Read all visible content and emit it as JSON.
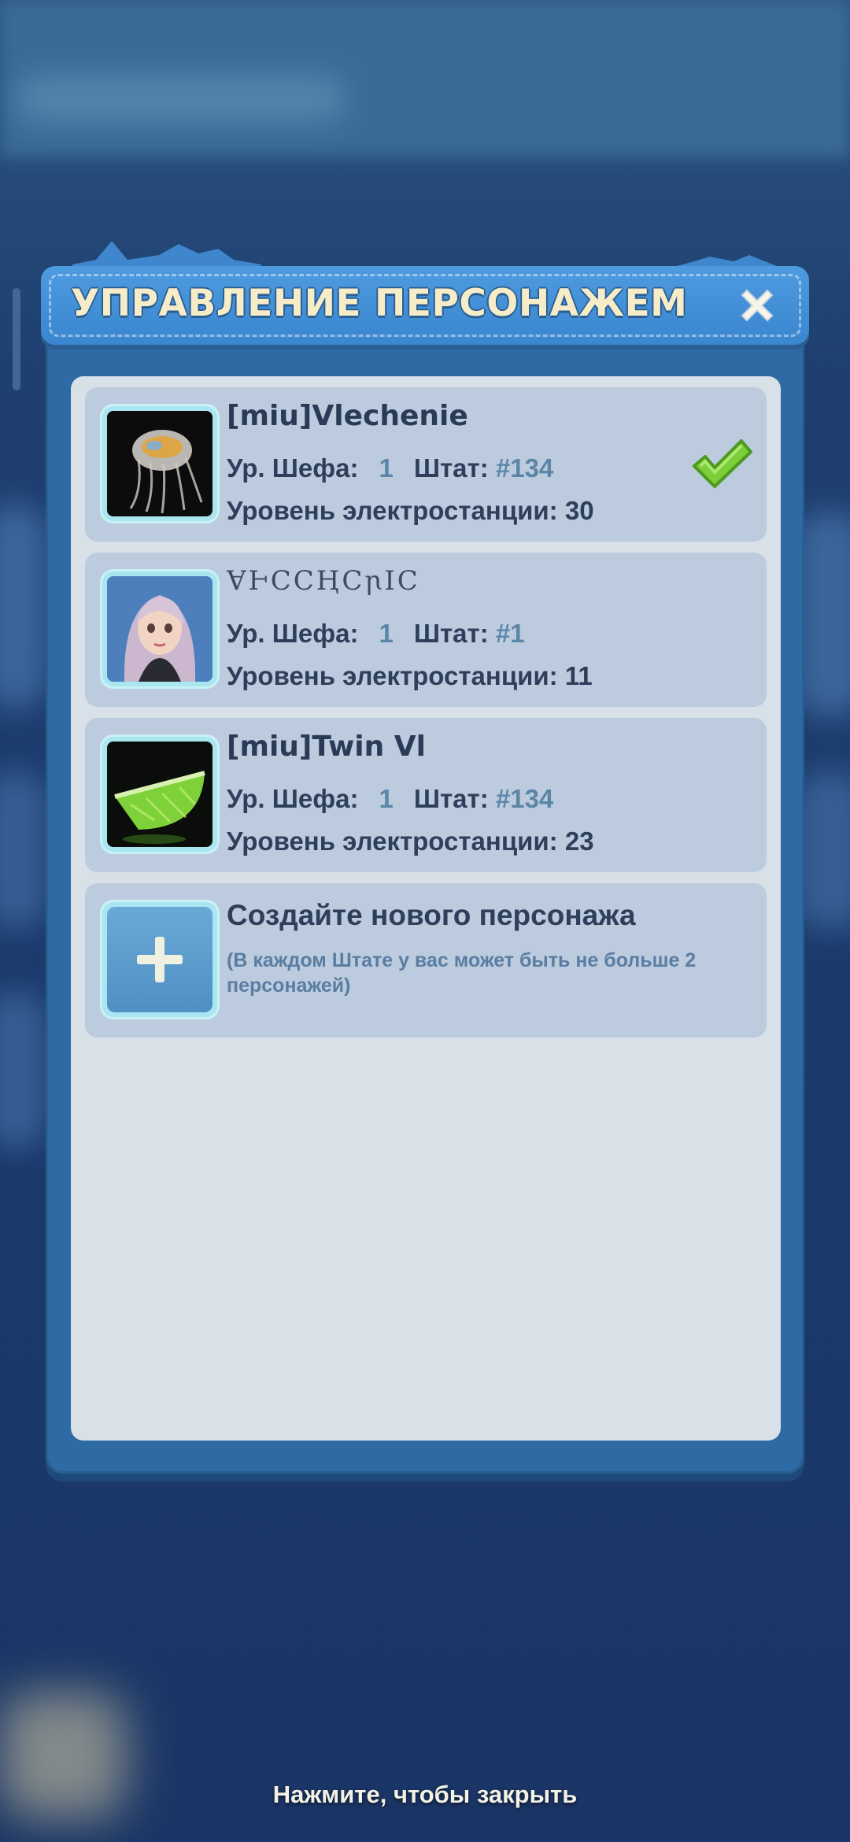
{
  "dialog": {
    "title": "УПРАВЛЕНИЕ ПЕРСОНАЖЕМ",
    "close_icon": "close-icon"
  },
  "characters": [
    {
      "name": "[miu]Vlechenie",
      "chef_label": "Ур. Шефа:",
      "chef_level": "1",
      "state_label": "Штат:",
      "state": "#134",
      "plant_label": "Уровень электростанции:",
      "plant_level": "30",
      "avatar": "jellyfish-avatar",
      "selected": true
    },
    {
      "name": "ⱯⱵⅭⅭⱧⅭꞃⅠⅭ",
      "chef_label": "Ур. Шефа:",
      "chef_level": "1",
      "state_label": "Штат:",
      "state": "#1",
      "plant_label": "Уровень электростанции:",
      "plant_level": "11",
      "avatar": "girl-portrait-avatar",
      "selected": false
    },
    {
      "name": "[miu]Twin Vl",
      "chef_label": "Ур. Шефа:",
      "chef_level": "1",
      "state_label": "Штат:",
      "state": "#134",
      "plant_label": "Уровень электростанции:",
      "plant_level": "23",
      "avatar": "lime-slice-avatar",
      "selected": false
    }
  ],
  "create": {
    "title": "Создайте нового персонажа",
    "note": "(В каждом Штате у вас может быть не больше 2 персонажей)"
  },
  "footer": {
    "hint": "Нажмите, чтобы закрыть"
  },
  "colors": {
    "header": "#3a86cf",
    "title_text": "#f6ecc8",
    "card_bg": "#bccbdd",
    "content_bg": "#d8e0e8",
    "value_accent": "#5c86a8",
    "check_green": "#7ccf3a"
  }
}
